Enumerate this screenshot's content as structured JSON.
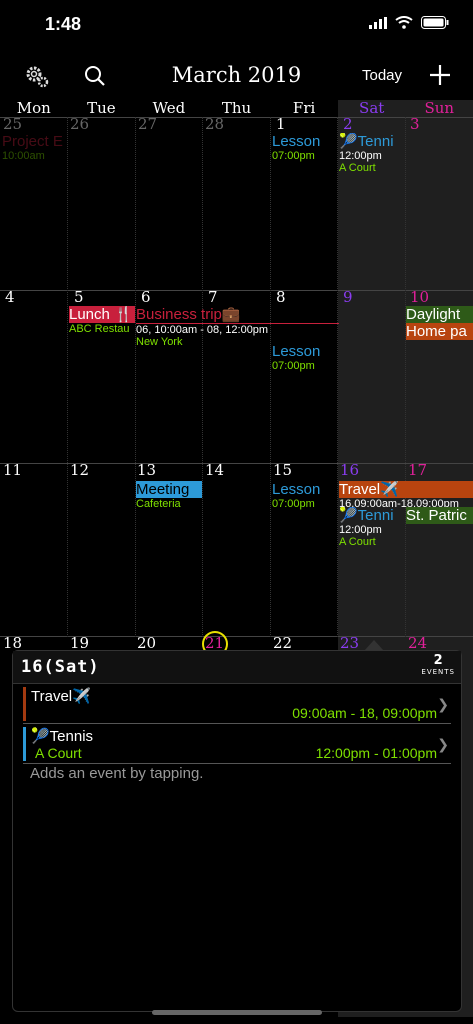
{
  "status": {
    "time": "1:48"
  },
  "nav": {
    "title": "March 2019",
    "today": "Today"
  },
  "weekdays": [
    "Mon",
    "Tue",
    "Wed",
    "Thu",
    "Fri",
    "Sat",
    "Sun"
  ],
  "weeks": [
    [
      "25",
      "26",
      "27",
      "28",
      "1",
      "2",
      "3"
    ],
    [
      "4",
      "5",
      "6",
      "7",
      "8",
      "9",
      "10"
    ],
    [
      "11",
      "12",
      "13",
      "14",
      "15",
      "16",
      "17"
    ],
    [
      "18",
      "19",
      "20",
      "21",
      "22",
      "23",
      "24"
    ]
  ],
  "events": {
    "project": {
      "title": "Project E",
      "sub": "10:00am"
    },
    "lesson1": {
      "title": "Lesson",
      "sub": "07:00pm"
    },
    "tennis1": {
      "title": "🎾Tenni",
      "sub": "12:00pm",
      "sub2": "A Court"
    },
    "lunch": {
      "title": "Lunch 🍴",
      "sub": "ABC Restau"
    },
    "business": {
      "title": "Business trip💼",
      "sub": "06, 10:00am - 08, 12:00pm",
      "sub2": "New York"
    },
    "daylight": {
      "title": "Daylight"
    },
    "homepa": {
      "title": "Home pa"
    },
    "lesson2": {
      "title": "Lesson",
      "sub": "07:00pm"
    },
    "meeting": {
      "title": "Meeting",
      "sub": "Cafeteria"
    },
    "lesson3": {
      "title": "Lesson",
      "sub": "07:00pm"
    },
    "travel": {
      "title": "Travel✈️",
      "sub": "16,09:00am-18,09:00pm"
    },
    "tennis2": {
      "title": "🎾Tenni",
      "sub": "12:00pm",
      "sub2": "A Court"
    },
    "stpatrick": {
      "title": "St. Patric"
    }
  },
  "panel": {
    "day": "16(Sat)",
    "count": "2",
    "count_label": "EVENTS",
    "items": [
      {
        "title": "Travel✈️",
        "sub": "",
        "time": "09:00am - 18, 09:00pm",
        "color": "#a33a10"
      },
      {
        "title": "🎾Tennis",
        "sub": "A Court",
        "time": "12:00pm - 01:00pm",
        "color": "#2d9ad8"
      }
    ],
    "hint": "Adds an event by tapping."
  },
  "colors": {
    "sat": "#8a3cf0",
    "sun": "#e0209a",
    "green": "#7fe000",
    "blue": "#2d9ad8",
    "red": "#c8203c",
    "orange": "#b8440f"
  }
}
